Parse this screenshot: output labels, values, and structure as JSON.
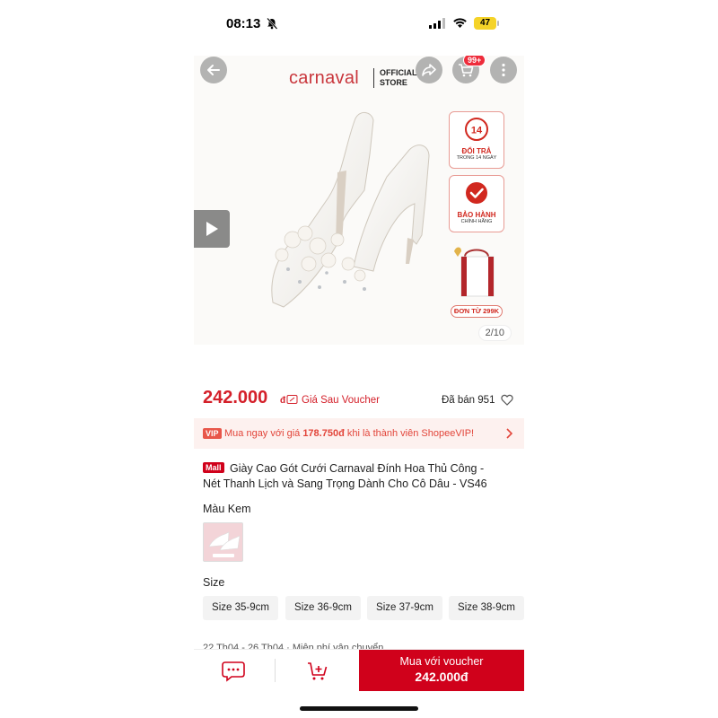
{
  "status_bar": {
    "time": "08:13",
    "battery": "47"
  },
  "header": {
    "brand": "carnaval",
    "brand_tag_line1": "OFFICIAL",
    "brand_tag_line2": "STORE",
    "cart_badge": "99+",
    "icons": [
      "back-arrow-icon",
      "share-icon",
      "cart-icon",
      "more-icon"
    ]
  },
  "gallery": {
    "counter": "2/10",
    "badges": {
      "return_days": "14",
      "return_title": "ĐỔI TRẢ",
      "return_sub": "TRONG 14 NGÀY",
      "warranty_title": "BẢO HÀNH",
      "warranty_sub": "CHÍNH HÃNG",
      "gift_text": "ĐƠN TỪ 299K"
    }
  },
  "price": {
    "amount": "242.000",
    "currency": "đ",
    "note": "Giá Sau Voucher",
    "sold": "Đã bán 951"
  },
  "vip": {
    "tag": "VIP",
    "text": "Mua ngay với giá ",
    "price": "178.750đ",
    "text_after": " khi là thành viên ShopeeVIP!"
  },
  "product": {
    "mall_tag": "Mall",
    "title_line1": "Giày Cao Gót Cưới Carnaval Đính Hoa Thủ Công -",
    "title_line2": "Nét Thanh Lịch và Sang Trọng Dành Cho Cô Dâu - VS46"
  },
  "variants": {
    "label": "Màu Kem"
  },
  "sizes": {
    "label": "Size",
    "options": [
      "Size 35-9cm",
      "Size 36-9cm",
      "Size 37-9cm",
      "Size 38-9cm"
    ]
  },
  "shipping": {
    "text": "22 Th04 - 26 Th04 · Miễn phí vận chuyển"
  },
  "bottom_bar": {
    "buy_label": "Mua với voucher",
    "buy_price": "242.000đ"
  },
  "colors": {
    "accent_red": "#d0011b",
    "price_red": "#d4202a",
    "vip_bg": "#fdf1ef"
  }
}
